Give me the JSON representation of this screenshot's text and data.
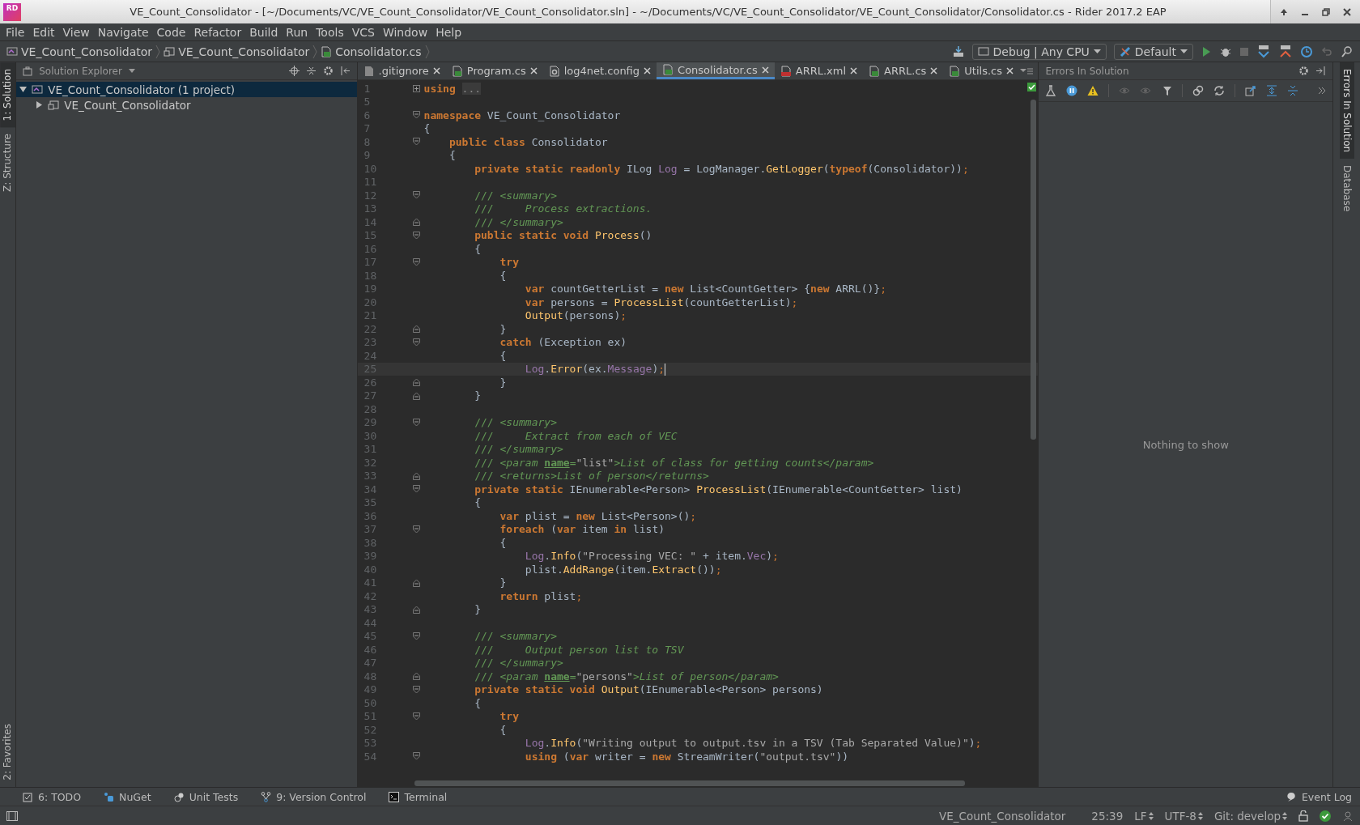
{
  "window": {
    "logo_text": "RD",
    "title": "VE_Count_Consolidator - [~/Documents/VC/VE_Count_Consolidator/VE_Count_Consolidator.sln] - ~/Documents/VC/VE_Count_Consolidator/VE_Count_Consolidator/Consolidator.cs - Rider 2017.2 EAP"
  },
  "menu": [
    "File",
    "Edit",
    "View",
    "Navigate",
    "Code",
    "Refactor",
    "Build",
    "Run",
    "Tools",
    "VCS",
    "Window",
    "Help"
  ],
  "breadcrumb": [
    {
      "kind": "solution",
      "label": "VE_Count_Consolidator"
    },
    {
      "kind": "project",
      "label": "VE_Count_Consolidator"
    },
    {
      "kind": "cs",
      "label": "Consolidator.cs"
    }
  ],
  "toolbar": {
    "configuration": "Debug | Any CPU",
    "run_target": "Default"
  },
  "left_stripe": [
    {
      "label": "1: Solution",
      "selected": true
    },
    {
      "label": "Z: Structure",
      "selected": false
    }
  ],
  "left_stripe_bottom": [
    {
      "label": "2: Favorites",
      "selected": false
    }
  ],
  "right_stripe": [
    {
      "label": "Errors In Solution",
      "selected": true
    },
    {
      "label": "Database",
      "selected": false
    }
  ],
  "solution_explorer": {
    "title": "Solution Explorer",
    "tree": [
      {
        "label": "VE_Count_Consolidator (1 project)",
        "kind": "solution",
        "selected": true,
        "expanded": true,
        "children": [
          {
            "label": "VE_Count_Consolidator",
            "kind": "project",
            "selected": false,
            "expanded": false
          }
        ]
      }
    ]
  },
  "tabs": [
    {
      "label": ".gitignore",
      "kind": "file",
      "selected": false
    },
    {
      "label": "Program.cs",
      "kind": "cs",
      "selected": false
    },
    {
      "label": "log4net.config",
      "kind": "config",
      "selected": false
    },
    {
      "label": "Consolidator.cs",
      "kind": "cs",
      "selected": true
    },
    {
      "label": "ARRL.xml",
      "kind": "xml",
      "selected": false
    },
    {
      "label": "ARRL.cs",
      "kind": "cs",
      "selected": false
    },
    {
      "label": "Utils.cs",
      "kind": "cs",
      "selected": false
    }
  ],
  "editor": {
    "lines": [
      {
        "number": "1",
        "current": false,
        "kind": "collapsed",
        "tokens": [
          {
            "kind": "kw",
            "text": "using "
          },
          {
            "kind": "folded",
            "text": "..."
          }
        ]
      },
      {
        "number": "5",
        "current": false,
        "kind": "plain"
      },
      {
        "number": "6",
        "current": false,
        "kind": "open",
        "tokens": [
          {
            "kind": "kw",
            "text": "namespace"
          },
          {
            "kind": "plain",
            "text": " VE_Count_Consolidator"
          }
        ]
      },
      {
        "number": "7",
        "current": false,
        "kind": "plain",
        "tokens": [
          {
            "kind": "plain",
            "text": "{"
          }
        ]
      },
      {
        "number": "8",
        "current": false,
        "kind": "open",
        "tokens": [
          {
            "kind": "kw",
            "text": "    public class"
          },
          {
            "kind": "plain",
            "text": " Consolidator"
          }
        ]
      },
      {
        "number": "9",
        "current": false,
        "kind": "plain",
        "tokens": [
          {
            "kind": "plain",
            "text": "    {"
          }
        ]
      },
      {
        "number": "10",
        "current": false,
        "kind": "plain",
        "tokens": [
          {
            "kind": "kw",
            "text": "        private static readonly"
          },
          {
            "kind": "plain",
            "text": " ILog "
          },
          {
            "kind": "field",
            "text": "Log"
          },
          {
            "kind": "plain",
            "text": " = LogManager."
          },
          {
            "kind": "method",
            "text": "GetLogger"
          },
          {
            "kind": "plain",
            "text": "("
          },
          {
            "kind": "kw",
            "text": "typeof"
          },
          {
            "kind": "plain",
            "text": "(Consolidator))"
          },
          {
            "kind": "punct",
            "text": ";"
          }
        ]
      },
      {
        "number": "11",
        "current": false,
        "kind": "plain"
      },
      {
        "number": "12",
        "current": false,
        "kind": "open",
        "tokens": [
          {
            "kind": "docmark",
            "text": "        ///"
          },
          {
            "kind": "doc",
            "text": " <summary>"
          }
        ]
      },
      {
        "number": "13",
        "current": false,
        "kind": "plain",
        "tokens": [
          {
            "kind": "docmark",
            "text": "        ///"
          },
          {
            "kind": "doc",
            "text": "     Process extractions."
          }
        ]
      },
      {
        "number": "14",
        "current": false,
        "kind": "end",
        "tokens": [
          {
            "kind": "docmark",
            "text": "        ///"
          },
          {
            "kind": "doc",
            "text": " </summary>"
          }
        ]
      },
      {
        "number": "15",
        "current": false,
        "kind": "open",
        "tokens": [
          {
            "kind": "kw",
            "text": "        public static void "
          },
          {
            "kind": "method",
            "text": "Process"
          },
          {
            "kind": "plain",
            "text": "()"
          }
        ]
      },
      {
        "number": "16",
        "current": false,
        "kind": "plain",
        "tokens": [
          {
            "kind": "plain",
            "text": "        {"
          }
        ]
      },
      {
        "number": "17",
        "current": false,
        "kind": "open",
        "tokens": [
          {
            "kind": "kw",
            "text": "            try"
          }
        ]
      },
      {
        "number": "18",
        "current": false,
        "kind": "plain",
        "tokens": [
          {
            "kind": "plain",
            "text": "            {"
          }
        ]
      },
      {
        "number": "19",
        "current": false,
        "kind": "plain",
        "tokens": [
          {
            "kind": "kw",
            "text": "                var"
          },
          {
            "kind": "plain",
            "text": " countGetterList = "
          },
          {
            "kind": "kw",
            "text": "new"
          },
          {
            "kind": "plain",
            "text": " List<CountGetter> {"
          },
          {
            "kind": "kw",
            "text": "new"
          },
          {
            "kind": "plain",
            "text": " ARRL()}"
          },
          {
            "kind": "punct",
            "text": ";"
          }
        ]
      },
      {
        "number": "20",
        "current": false,
        "kind": "plain",
        "tokens": [
          {
            "kind": "kw",
            "text": "                var"
          },
          {
            "kind": "plain",
            "text": " persons = "
          },
          {
            "kind": "method",
            "text": "ProcessList"
          },
          {
            "kind": "plain",
            "text": "(countGetterList)"
          },
          {
            "kind": "punct",
            "text": ";"
          }
        ]
      },
      {
        "number": "21",
        "current": false,
        "kind": "plain",
        "tokens": [
          {
            "kind": "method",
            "text": "                Output"
          },
          {
            "kind": "plain",
            "text": "(persons)"
          },
          {
            "kind": "punct",
            "text": ";"
          }
        ]
      },
      {
        "number": "22",
        "current": false,
        "kind": "end",
        "tokens": [
          {
            "kind": "plain",
            "text": "            }"
          }
        ]
      },
      {
        "number": "23",
        "current": false,
        "kind": "open",
        "tokens": [
          {
            "kind": "kw",
            "text": "            catch"
          },
          {
            "kind": "plain",
            "text": " (Exception ex)"
          }
        ]
      },
      {
        "number": "24",
        "current": false,
        "kind": "plain",
        "tokens": [
          {
            "kind": "plain",
            "text": "            {"
          }
        ]
      },
      {
        "number": "25",
        "current": true,
        "kind": "plain",
        "tokens": [
          {
            "kind": "field",
            "text": "                Log"
          },
          {
            "kind": "plain",
            "text": "."
          },
          {
            "kind": "method",
            "text": "Error"
          },
          {
            "kind": "plain",
            "text": "(ex."
          },
          {
            "kind": "field",
            "text": "Message"
          },
          {
            "kind": "plain",
            "text": ")"
          },
          {
            "kind": "punct",
            "text": ";"
          }
        ]
      },
      {
        "number": "26",
        "current": false,
        "kind": "end",
        "tokens": [
          {
            "kind": "plain",
            "text": "            }"
          }
        ]
      },
      {
        "number": "27",
        "current": false,
        "kind": "end",
        "tokens": [
          {
            "kind": "plain",
            "text": "        }"
          }
        ]
      },
      {
        "number": "28",
        "current": false,
        "kind": "plain"
      },
      {
        "number": "29",
        "current": false,
        "kind": "open",
        "tokens": [
          {
            "kind": "docmark",
            "text": "        ///"
          },
          {
            "kind": "doc",
            "text": " <summary>"
          }
        ]
      },
      {
        "number": "30",
        "current": false,
        "kind": "plain",
        "tokens": [
          {
            "kind": "docmark",
            "text": "        ///"
          },
          {
            "kind": "doc",
            "text": "     Extract from each of VEC"
          }
        ]
      },
      {
        "number": "31",
        "current": false,
        "kind": "plain",
        "tokens": [
          {
            "kind": "docmark",
            "text": "        ///"
          },
          {
            "kind": "doc",
            "text": " </summary>"
          }
        ]
      },
      {
        "number": "32",
        "current": false,
        "kind": "plain",
        "tokens": [
          {
            "kind": "docmark",
            "text": "        ///"
          },
          {
            "kind": "doc",
            "text": " <param "
          },
          {
            "kind": "docattr",
            "text": "name"
          },
          {
            "kind": "doc",
            "text": "="
          },
          {
            "kind": "str",
            "text": "\"list\""
          },
          {
            "kind": "doc",
            "text": ">List of class for getting counts</param>"
          }
        ]
      },
      {
        "number": "33",
        "current": false,
        "kind": "end",
        "tokens": [
          {
            "kind": "docmark",
            "text": "        ///"
          },
          {
            "kind": "doc",
            "text": " <returns>List of person</returns>"
          }
        ]
      },
      {
        "number": "34",
        "current": false,
        "kind": "open",
        "tokens": [
          {
            "kind": "kw",
            "text": "        private static"
          },
          {
            "kind": "plain",
            "text": " IEnumerable<Person> "
          },
          {
            "kind": "method",
            "text": "ProcessList"
          },
          {
            "kind": "plain",
            "text": "(IEnumerable<CountGetter> list)"
          }
        ]
      },
      {
        "number": "35",
        "current": false,
        "kind": "plain",
        "tokens": [
          {
            "kind": "plain",
            "text": "        {"
          }
        ]
      },
      {
        "number": "36",
        "current": false,
        "kind": "plain",
        "tokens": [
          {
            "kind": "kw",
            "text": "            var"
          },
          {
            "kind": "plain",
            "text": " plist = "
          },
          {
            "kind": "kw",
            "text": "new"
          },
          {
            "kind": "plain",
            "text": " List<Person>()"
          },
          {
            "kind": "punct",
            "text": ";"
          }
        ]
      },
      {
        "number": "37",
        "current": false,
        "kind": "open",
        "tokens": [
          {
            "kind": "kw",
            "text": "            foreach"
          },
          {
            "kind": "plain",
            "text": " ("
          },
          {
            "kind": "kw",
            "text": "var"
          },
          {
            "kind": "plain",
            "text": " item "
          },
          {
            "kind": "kw",
            "text": "in"
          },
          {
            "kind": "plain",
            "text": " list)"
          }
        ]
      },
      {
        "number": "38",
        "current": false,
        "kind": "plain",
        "tokens": [
          {
            "kind": "plain",
            "text": "            {"
          }
        ]
      },
      {
        "number": "39",
        "current": false,
        "kind": "plain",
        "tokens": [
          {
            "kind": "field",
            "text": "                Log"
          },
          {
            "kind": "plain",
            "text": "."
          },
          {
            "kind": "method",
            "text": "Info"
          },
          {
            "kind": "plain",
            "text": "("
          },
          {
            "kind": "str",
            "text": "\"Processing VEC: \""
          },
          {
            "kind": "plain",
            "text": " + item."
          },
          {
            "kind": "field",
            "text": "Vec"
          },
          {
            "kind": "plain",
            "text": ")"
          },
          {
            "kind": "punct",
            "text": ";"
          }
        ]
      },
      {
        "number": "40",
        "current": false,
        "kind": "plain",
        "tokens": [
          {
            "kind": "plain",
            "text": "                plist."
          },
          {
            "kind": "method",
            "text": "AddRange"
          },
          {
            "kind": "plain",
            "text": "(item."
          },
          {
            "kind": "method",
            "text": "Extract"
          },
          {
            "kind": "plain",
            "text": "())"
          },
          {
            "kind": "punct",
            "text": ";"
          }
        ]
      },
      {
        "number": "41",
        "current": false,
        "kind": "end",
        "tokens": [
          {
            "kind": "plain",
            "text": "            }"
          }
        ]
      },
      {
        "number": "42",
        "current": false,
        "kind": "plain",
        "tokens": [
          {
            "kind": "kw",
            "text": "            return"
          },
          {
            "kind": "plain",
            "text": " plist"
          },
          {
            "kind": "punct",
            "text": ";"
          }
        ]
      },
      {
        "number": "43",
        "current": false,
        "kind": "end",
        "tokens": [
          {
            "kind": "plain",
            "text": "        }"
          }
        ]
      },
      {
        "number": "44",
        "current": false,
        "kind": "plain"
      },
      {
        "number": "45",
        "current": false,
        "kind": "open",
        "tokens": [
          {
            "kind": "docmark",
            "text": "        ///"
          },
          {
            "kind": "doc",
            "text": " <summary>"
          }
        ]
      },
      {
        "number": "46",
        "current": false,
        "kind": "plain",
        "tokens": [
          {
            "kind": "docmark",
            "text": "        ///"
          },
          {
            "kind": "doc",
            "text": "     Output person list to TSV"
          }
        ]
      },
      {
        "number": "47",
        "current": false,
        "kind": "plain",
        "tokens": [
          {
            "kind": "docmark",
            "text": "        ///"
          },
          {
            "kind": "doc",
            "text": " </summary>"
          }
        ]
      },
      {
        "number": "48",
        "current": false,
        "kind": "end",
        "tokens": [
          {
            "kind": "docmark",
            "text": "        ///"
          },
          {
            "kind": "doc",
            "text": " <param "
          },
          {
            "kind": "docattr",
            "text": "name"
          },
          {
            "kind": "doc",
            "text": "="
          },
          {
            "kind": "str",
            "text": "\"persons\""
          },
          {
            "kind": "doc",
            "text": ">List of person</param>"
          }
        ]
      },
      {
        "number": "49",
        "current": false,
        "kind": "open",
        "tokens": [
          {
            "kind": "kw",
            "text": "        private static void "
          },
          {
            "kind": "method",
            "text": "Output"
          },
          {
            "kind": "plain",
            "text": "(IEnumerable<Person> persons)"
          }
        ]
      },
      {
        "number": "50",
        "current": false,
        "kind": "plain",
        "tokens": [
          {
            "kind": "plain",
            "text": "        {"
          }
        ]
      },
      {
        "number": "51",
        "current": false,
        "kind": "open",
        "tokens": [
          {
            "kind": "kw",
            "text": "            try"
          }
        ]
      },
      {
        "number": "52",
        "current": false,
        "kind": "plain",
        "tokens": [
          {
            "kind": "plain",
            "text": "            {"
          }
        ]
      },
      {
        "number": "53",
        "current": false,
        "kind": "plain",
        "tokens": [
          {
            "kind": "field",
            "text": "                Log"
          },
          {
            "kind": "plain",
            "text": "."
          },
          {
            "kind": "method",
            "text": "Info"
          },
          {
            "kind": "plain",
            "text": "("
          },
          {
            "kind": "str",
            "text": "\"Writing output to output.tsv in a TSV (Tab Separated Value)\""
          },
          {
            "kind": "plain",
            "text": ")"
          },
          {
            "kind": "punct",
            "text": ";"
          }
        ]
      },
      {
        "number": "54",
        "current": false,
        "kind": "open",
        "tokens": [
          {
            "kind": "kw",
            "text": "                using"
          },
          {
            "kind": "plain",
            "text": " ("
          },
          {
            "kind": "kw",
            "text": "var"
          },
          {
            "kind": "plain",
            "text": " writer = "
          },
          {
            "kind": "kw",
            "text": "new"
          },
          {
            "kind": "plain",
            "text": " StreamWriter("
          },
          {
            "kind": "str",
            "text": "\"output.tsv\""
          },
          {
            "kind": "plain",
            "text": "))"
          }
        ]
      }
    ]
  },
  "errors_panel": {
    "title": "Errors In Solution",
    "empty_text": "Nothing to show"
  },
  "tool_buttons": [
    {
      "kind": "todo",
      "label": "6: TODO"
    },
    {
      "kind": "nuget",
      "label": "NuGet"
    },
    {
      "kind": "tests",
      "label": "Unit Tests"
    },
    {
      "kind": "vcs",
      "label": "9: Version Control"
    },
    {
      "kind": "terminal",
      "label": "Terminal"
    }
  ],
  "event_log": "Event Log",
  "status_bar": {
    "project": "VE_Count_Consolidator",
    "position": "25:39",
    "line_separator": "LF",
    "encoding": "UTF-8",
    "branch": "Git: develop"
  }
}
